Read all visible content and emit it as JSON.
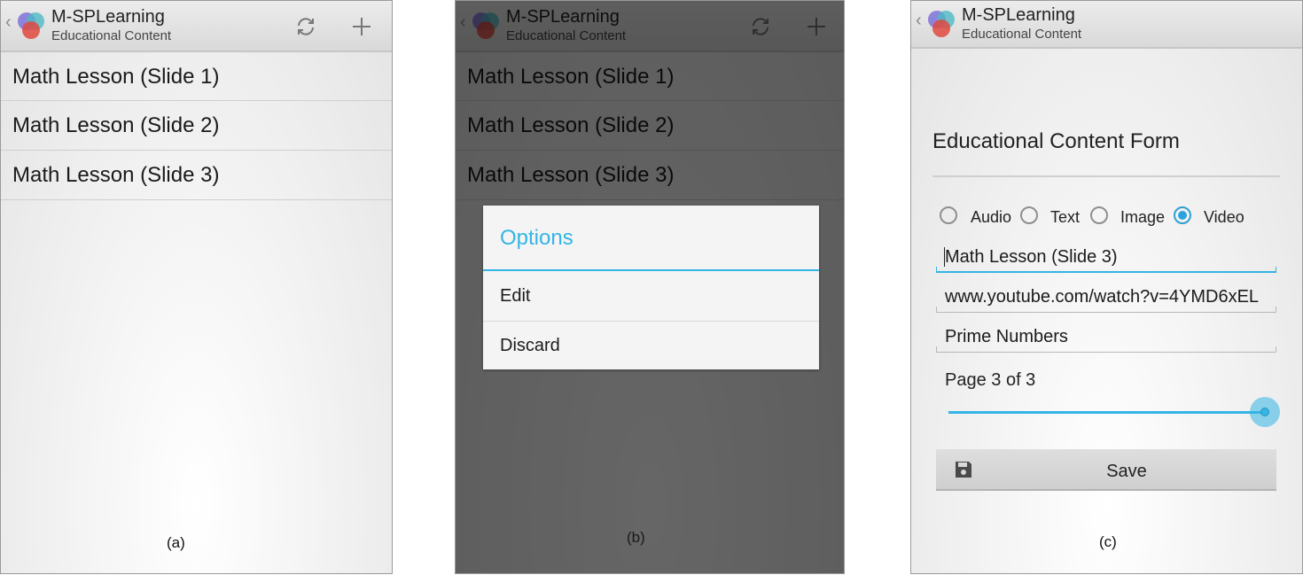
{
  "app": {
    "title": "M-SPLearning",
    "subtitle": "Educational Content",
    "refresh_icon": "refresh-icon",
    "add_icon": "add-icon",
    "accent_color": "#33b5e5"
  },
  "lessons": [
    "Math Lesson (Slide 1)",
    "Math Lesson (Slide 2)",
    "Math Lesson (Slide 3)"
  ],
  "dialog": {
    "title": "Options",
    "items": [
      "Edit",
      "Discard"
    ]
  },
  "form": {
    "title": "Educational Content Form",
    "media_types": [
      {
        "label": "Audio",
        "checked": false
      },
      {
        "label": "Text",
        "checked": false
      },
      {
        "label": "Image",
        "checked": false
      },
      {
        "label": "Video",
        "checked": true
      }
    ],
    "title_value": "Math Lesson (Slide 3)",
    "url_value": "www.youtube.com/watch?v=4YMD6xEL",
    "topic_value": "Prime Numbers",
    "page_label": "Page 3 of 3",
    "page_current": 3,
    "page_total": 3,
    "save_label": "Save",
    "save_icon": "save-icon"
  },
  "captions": [
    "(a)",
    "(b)",
    "(c)"
  ]
}
